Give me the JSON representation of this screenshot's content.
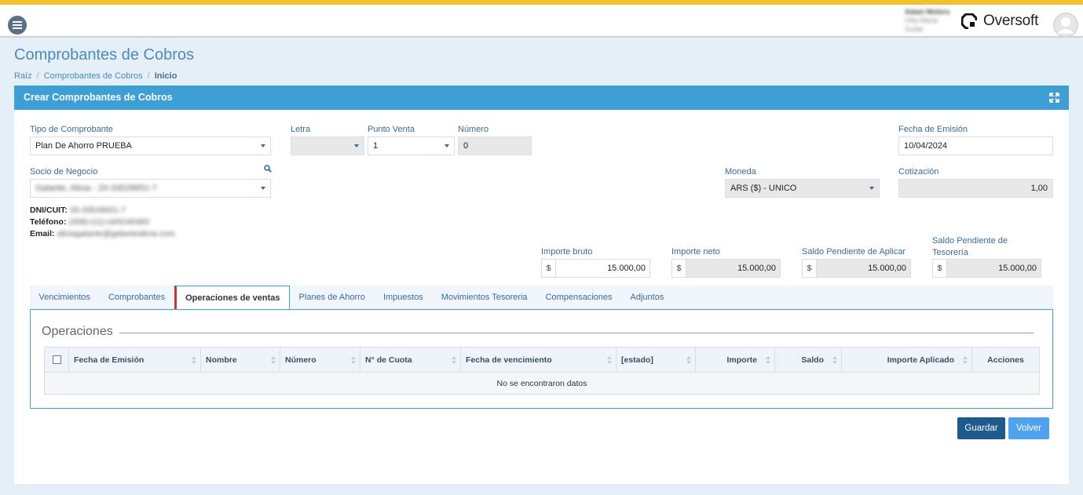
{
  "topbar": {
    "user_name": "Adam Motors",
    "user_line2": "Villa Maria",
    "user_line3": "Sudar",
    "brand": "Oversoft",
    "colors": {
      "stripe": "#f2c12e",
      "primary": "#3e9fd6"
    }
  },
  "page": {
    "title": "Comprobantes de Cobros",
    "breadcrumb": [
      "Raíz",
      "Comprobantes de Cobros",
      "Inicio"
    ]
  },
  "panel": {
    "title": "Crear Comprobantes de Cobros"
  },
  "form": {
    "tipo_label": "Tipo de Comprobante",
    "tipo_value": "Plan De Ahorro PRUEBA",
    "letra_label": "Letra",
    "letra_value": "",
    "punto_label": "Punto Venta",
    "punto_value": "1",
    "numero_label": "Número",
    "numero_value": "0",
    "fecha_label": "Fecha de Emisión",
    "fecha_value": "10/04/2024",
    "socio_label": "Socio de Negocio",
    "socio_value": "Galante, Alicia - 20-33528651-7",
    "moneda_label": "Moneda",
    "moneda_value": "ARS ($) - UNICO",
    "cotizacion_label": "Cotización",
    "cotizacion_value": "1,00",
    "dni_label": "DNI/CUIT:",
    "dni_value": "33-33528651-7",
    "telefono_label": "Teléfono:",
    "telefono_value": "(458)-(11)-(4/6246360",
    "email_label": "Email:",
    "email_value": "aliciagalante@galantealicia.com"
  },
  "importes": [
    {
      "label": "Importe bruto",
      "currency": "$",
      "value": "15.000,00"
    },
    {
      "label": "Importe neto",
      "currency": "$",
      "value": "15.000,00"
    },
    {
      "label": "Saldo Pendiente de Aplicar",
      "currency": "$",
      "value": "15.000,00"
    },
    {
      "label": "Saldo Pendiente de Tesorería",
      "currency": "$",
      "value": "15.000,00"
    }
  ],
  "tabs": [
    "Vencimientos",
    "Comprobantes",
    "Operaciones de ventas",
    "Planes de Ahorro",
    "Impuestos",
    "Movimientos Tesoreria",
    "Compensaciones",
    "Adjuntos"
  ],
  "operaciones": {
    "title": "Operaciones",
    "columns": [
      "Fecha de Emisión",
      "Nombre",
      "Número",
      "N° de Cuota",
      "Fecha de vencimiento",
      "[estado]",
      "Importe",
      "Saldo",
      "Importe Aplicado",
      "Acciones"
    ],
    "empty_text": "No se encontraron datos"
  },
  "buttons": {
    "save": "Guardar",
    "back": "Volver"
  }
}
